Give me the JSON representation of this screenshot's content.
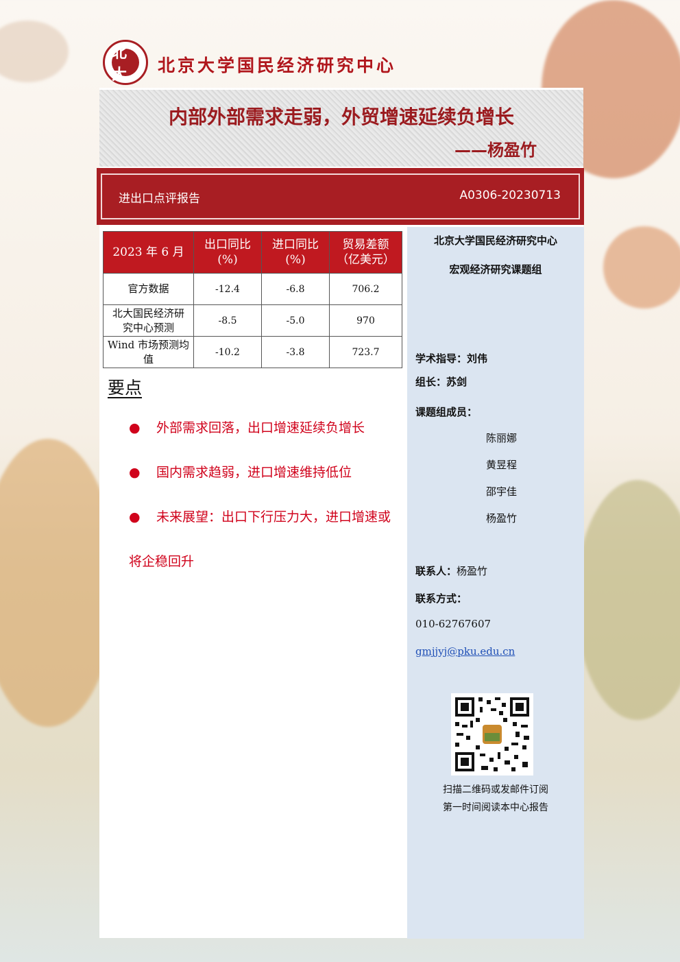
{
  "header": {
    "org_name": "北京大学国民经济研究中心",
    "logo_text": "北大"
  },
  "title": {
    "main": "内部外部需求走弱，外贸增速延续负增长",
    "author": "——杨盈竹"
  },
  "report_bar": {
    "type": "进出口点评报告",
    "code": "A0306-20230713"
  },
  "table": {
    "headers": [
      "2023 年 6 月",
      "出口同比\n(%)",
      "进口同比\n(%)",
      "贸易差额\n（亿美元）"
    ],
    "rows": [
      {
        "label": "官方数据",
        "export": "-12.4",
        "import": "-6.8",
        "balance": "706.2"
      },
      {
        "label": "北大国民经济研究中心预测",
        "export": "-8.5",
        "import": "-5.0",
        "balance": "970"
      },
      {
        "label": "Wind 市场预测均值",
        "export": "-10.2",
        "import": "-3.8",
        "balance": "723.7"
      }
    ]
  },
  "key_points": {
    "title": "要点",
    "bullet_glyph": "●",
    "items": [
      "外部需求回落，出口增速延续负增长",
      "国内需求趋弱，进口增速维持低位",
      "未来展望：出口下行压力大，进口增速或"
    ],
    "continuation": "将企稳回升"
  },
  "sidebar": {
    "org": "北京大学国民经济研究中心",
    "group": "宏观经济研究课题组",
    "advisor_label": "学术指导：",
    "advisor": "刘伟",
    "leader_label": "组长：",
    "leader": "苏剑",
    "members_label": "课题组成员：",
    "members": [
      "陈丽娜",
      "黄昱程",
      "邵宇佳",
      "杨盈竹"
    ],
    "contact_label": "联系人：",
    "contact": "杨盈竹",
    "method_label": "联系方式：",
    "phone": "010-62767607",
    "email": "gmjjyj@pku.edu.cn",
    "qr_caption_1": "扫描二维码或发邮件订阅",
    "qr_caption_2": "第一时间阅读本中心报告"
  }
}
